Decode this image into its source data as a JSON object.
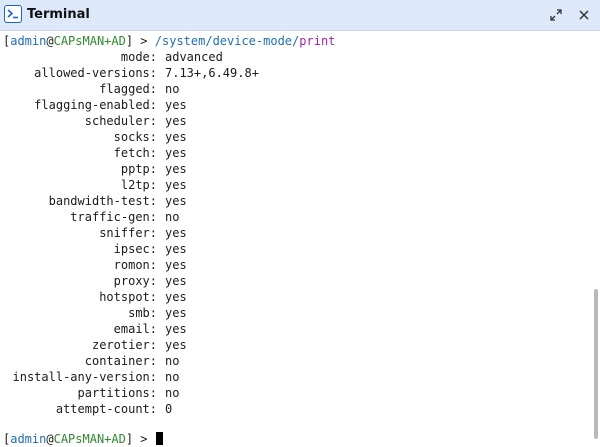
{
  "window": {
    "title": "Terminal"
  },
  "terminal": {
    "prompt": {
      "open_bracket": "[",
      "user": "admin",
      "at": "@",
      "host": "CAPsMAN+AD",
      "close_bracket": "]",
      "arrow": " > "
    },
    "command": {
      "path": "/system/device-mode/",
      "verb": "print"
    },
    "output": [
      {
        "key": "mode:",
        "value": "advanced"
      },
      {
        "key": "allowed-versions:",
        "value": "7.13+,6.49.8+"
      },
      {
        "key": "flagged:",
        "value": "no"
      },
      {
        "key": "flagging-enabled:",
        "value": "yes"
      },
      {
        "key": "scheduler:",
        "value": "yes"
      },
      {
        "key": "socks:",
        "value": "yes"
      },
      {
        "key": "fetch:",
        "value": "yes"
      },
      {
        "key": "pptp:",
        "value": "yes"
      },
      {
        "key": "l2tp:",
        "value": "yes"
      },
      {
        "key": "bandwidth-test:",
        "value": "yes"
      },
      {
        "key": "traffic-gen:",
        "value": "no"
      },
      {
        "key": "sniffer:",
        "value": "yes"
      },
      {
        "key": "ipsec:",
        "value": "yes"
      },
      {
        "key": "romon:",
        "value": "yes"
      },
      {
        "key": "proxy:",
        "value": "yes"
      },
      {
        "key": "hotspot:",
        "value": "yes"
      },
      {
        "key": "smb:",
        "value": "yes"
      },
      {
        "key": "email:",
        "value": "yes"
      },
      {
        "key": "zerotier:",
        "value": "yes"
      },
      {
        "key": "container:",
        "value": "no"
      },
      {
        "key": "install-any-version:",
        "value": "no"
      },
      {
        "key": "partitions:",
        "value": "no"
      },
      {
        "key": "attempt-count:",
        "value": "0"
      }
    ]
  },
  "icons": {
    "app": "terminal-prompt-icon",
    "restore": "restore-arrows-icon",
    "close": "close-icon"
  },
  "colors": {
    "titlebar": "#dde9fb",
    "icon_blue": "#1f62c8",
    "user": "#1f6fb0",
    "host": "#2f8a2f",
    "path": "#1f6fb0",
    "command": "#a323a8",
    "text": "#1b1b1b"
  }
}
